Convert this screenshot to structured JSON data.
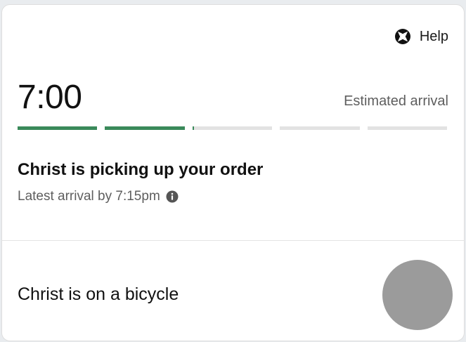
{
  "header": {
    "help_label": "Help",
    "help_icon": "lifebuoy-icon"
  },
  "eta": {
    "time": "7:00",
    "label": "Estimated arrival"
  },
  "progress": {
    "segments": [
      1,
      1,
      0.02,
      0,
      0
    ],
    "color": "#3a8a5a"
  },
  "status": {
    "title": "Christ is picking up your order",
    "latest_arrival": "Latest arrival by 7:15pm",
    "info_icon": "info-icon"
  },
  "courier": {
    "text": "Christ is on a bicycle"
  }
}
